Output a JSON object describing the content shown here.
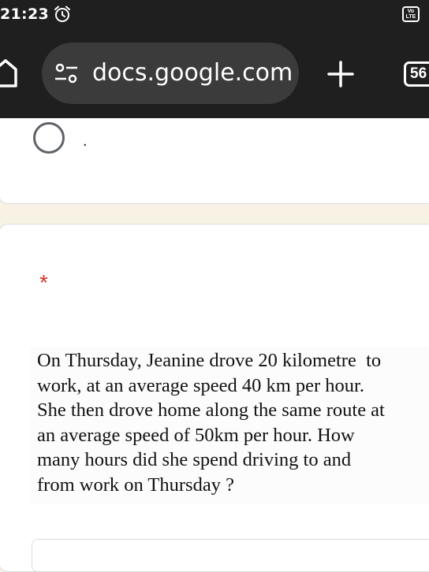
{
  "status_bar": {
    "time": "21:23",
    "alarm_icon": "alarm-icon",
    "network_badge": "Vo LTE"
  },
  "browser": {
    "home_icon": "home-icon",
    "site_settings_icon": "tune-icon",
    "url": "docs.google.com",
    "new_tab_icon": "plus-icon",
    "tab_count": "56"
  },
  "form": {
    "option_label": ".",
    "required_marker": "*",
    "question_lines": [
      "On Thursday, Jeanine drove 20 kilometre  to",
      "work, at an average speed 40 km per hour.",
      "She then drove home along the same route at",
      "an average speed of 50km per hour. How",
      "many hours did she spend driving to and",
      "from work on Thursday ?"
    ]
  }
}
